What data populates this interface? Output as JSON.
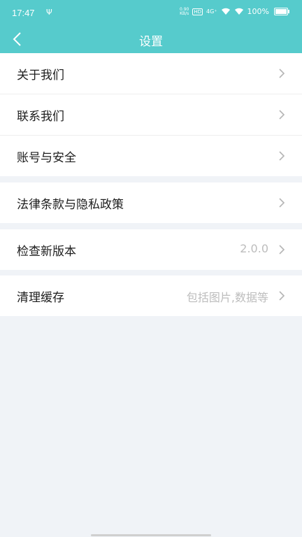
{
  "status_bar": {
    "time": "17:47",
    "usb": "Ψ",
    "speed_value": "0.90",
    "speed_unit": "KB/s",
    "hd": "HD",
    "network": "4G⁺",
    "battery": "100%"
  },
  "header": {
    "title": "设置"
  },
  "groups": [
    {
      "items": [
        {
          "label": "关于我们",
          "value": ""
        },
        {
          "label": "联系我们",
          "value": ""
        },
        {
          "label": "账号与安全",
          "value": ""
        }
      ]
    },
    {
      "items": [
        {
          "label": "法律条款与隐私政策",
          "value": ""
        }
      ]
    },
    {
      "items": [
        {
          "label": "检查新版本",
          "value": "2.0.0"
        }
      ]
    },
    {
      "items": [
        {
          "label": "清理缓存",
          "value": "包括图片,数据等"
        }
      ]
    }
  ],
  "colors": {
    "header_bg": "#56cbcc",
    "page_bg": "#f0f3f7"
  }
}
